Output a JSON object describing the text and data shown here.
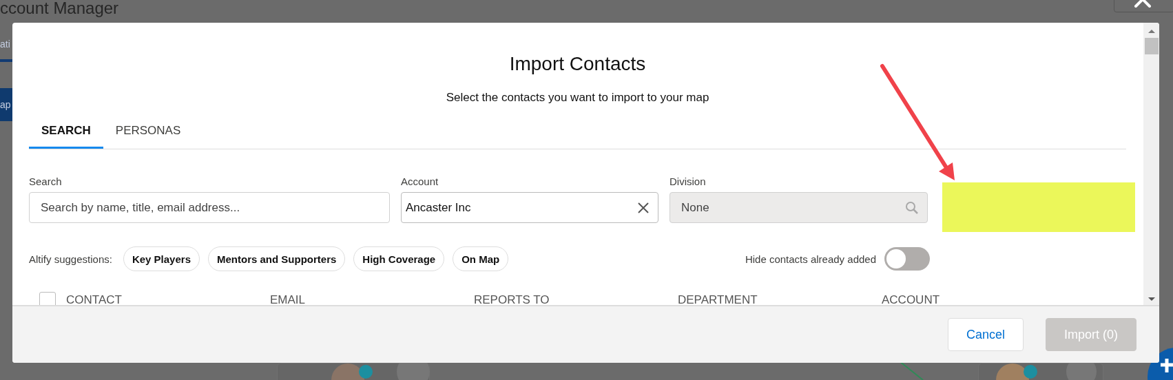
{
  "background": {
    "title": "ccount Manager",
    "tab": "ati",
    "button": "ap"
  },
  "dialog": {
    "title": "Import Contacts",
    "subtitle": "Select the contacts you want to import to your map",
    "tabs": [
      {
        "label": "SEARCH",
        "selected": true
      },
      {
        "label": "PERSONAS",
        "selected": false
      }
    ],
    "filters": [
      {
        "kind": "text",
        "label": "Search",
        "placeholder": "Search by name, title, email address..."
      },
      {
        "kind": "clearable",
        "label": "Account",
        "value": "Ancaster Inc"
      },
      {
        "kind": "lookup",
        "label": "Division",
        "value": "None",
        "disabled": true
      }
    ],
    "suggestions": {
      "label": "Altify suggestions:",
      "chips": [
        "Key Players",
        "Mentors and Supporters",
        "High Coverage",
        "On Map"
      ]
    },
    "hide_added": {
      "label": "Hide contacts already added",
      "on": false
    },
    "table": {
      "select_all_checked": false,
      "columns": [
        "CONTACT",
        "EMAIL",
        "REPORTS TO",
        "DEPARTMENT",
        "ACCOUNT"
      ]
    },
    "buttons": [
      {
        "label": "Cancel",
        "disabled": false
      },
      {
        "label": "Import (0)",
        "disabled": true
      }
    ]
  }
}
